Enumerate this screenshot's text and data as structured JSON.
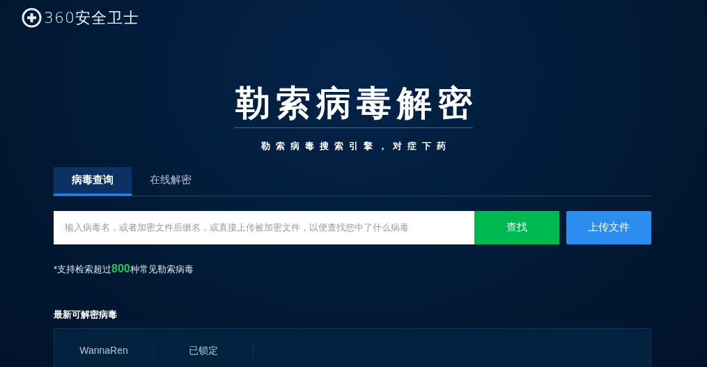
{
  "header": {
    "logo_text": "360安全卫士"
  },
  "hero": {
    "title": "勒索病毒解密",
    "subtitle": "勒索病毒搜索引擎，对症下药"
  },
  "tabs": [
    {
      "label": "病毒查询",
      "selected": true
    },
    {
      "label": "在线解密",
      "selected": false
    }
  ],
  "search": {
    "placeholder": "输入病毒名，或者加密文件后缀名，或直接上传被加密文件，以便查找您中了什么病毒"
  },
  "buttons": [
    {
      "label": "查找",
      "kind": "search"
    },
    {
      "label": "上传文件",
      "kind": "upload"
    }
  ],
  "note": "*支持检索超过**800**种常见勒索病毒",
  "latest": {
    "heading": "最新可解密病毒",
    "rows": [
      {
        "cells": [
          "WannaRen",
          "已锁定"
        ]
      }
    ]
  }
}
